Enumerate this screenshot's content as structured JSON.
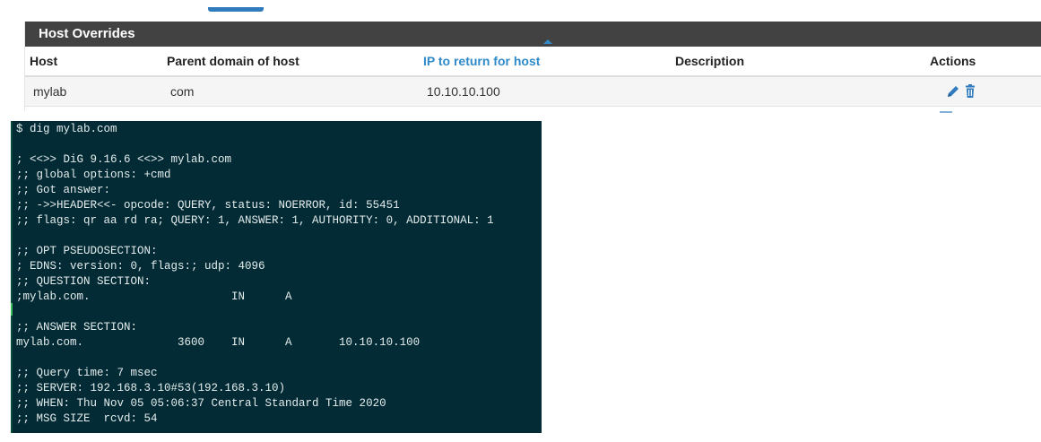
{
  "panel": {
    "title": "Host Overrides",
    "columns": [
      "Host",
      "Parent domain of host",
      "IP to return for host",
      "Description",
      "Actions"
    ],
    "sorted_column": "IP to return for host",
    "rows": [
      {
        "host": "mylab",
        "domain": "com",
        "ip": "10.10.10.100",
        "description": ""
      }
    ]
  },
  "terminal": {
    "lines": [
      "$ dig mylab.com",
      "",
      "; <<>> DiG 9.16.6 <<>> mylab.com",
      ";; global options: +cmd",
      ";; Got answer:",
      ";; ->>HEADER<<- opcode: QUERY, status: NOERROR, id: 55451",
      ";; flags: qr aa rd ra; QUERY: 1, ANSWER: 1, AUTHORITY: 0, ADDITIONAL: 1",
      "",
      ";; OPT PSEUDOSECTION:",
      "; EDNS: version: 0, flags:; udp: 4096",
      ";; QUESTION SECTION:",
      ";mylab.com.                     IN      A",
      "",
      ";; ANSWER SECTION:",
      "mylab.com.              3600    IN      A       10.10.10.100",
      "",
      ";; Query time: 7 msec",
      ";; SERVER: 192.168.3.10#53(192.168.3.10)",
      ";; WHEN: Thu Nov 05 05:06:37 Central Standard Time 2020",
      ";; MSG SIZE  rcvd: 54"
    ]
  },
  "icons": {
    "edit": "pencil-icon",
    "delete": "trash-icon"
  },
  "colors": {
    "panel_header": "#424242",
    "accent": "#2f8ac9",
    "terminal_bg": "#032b35"
  }
}
